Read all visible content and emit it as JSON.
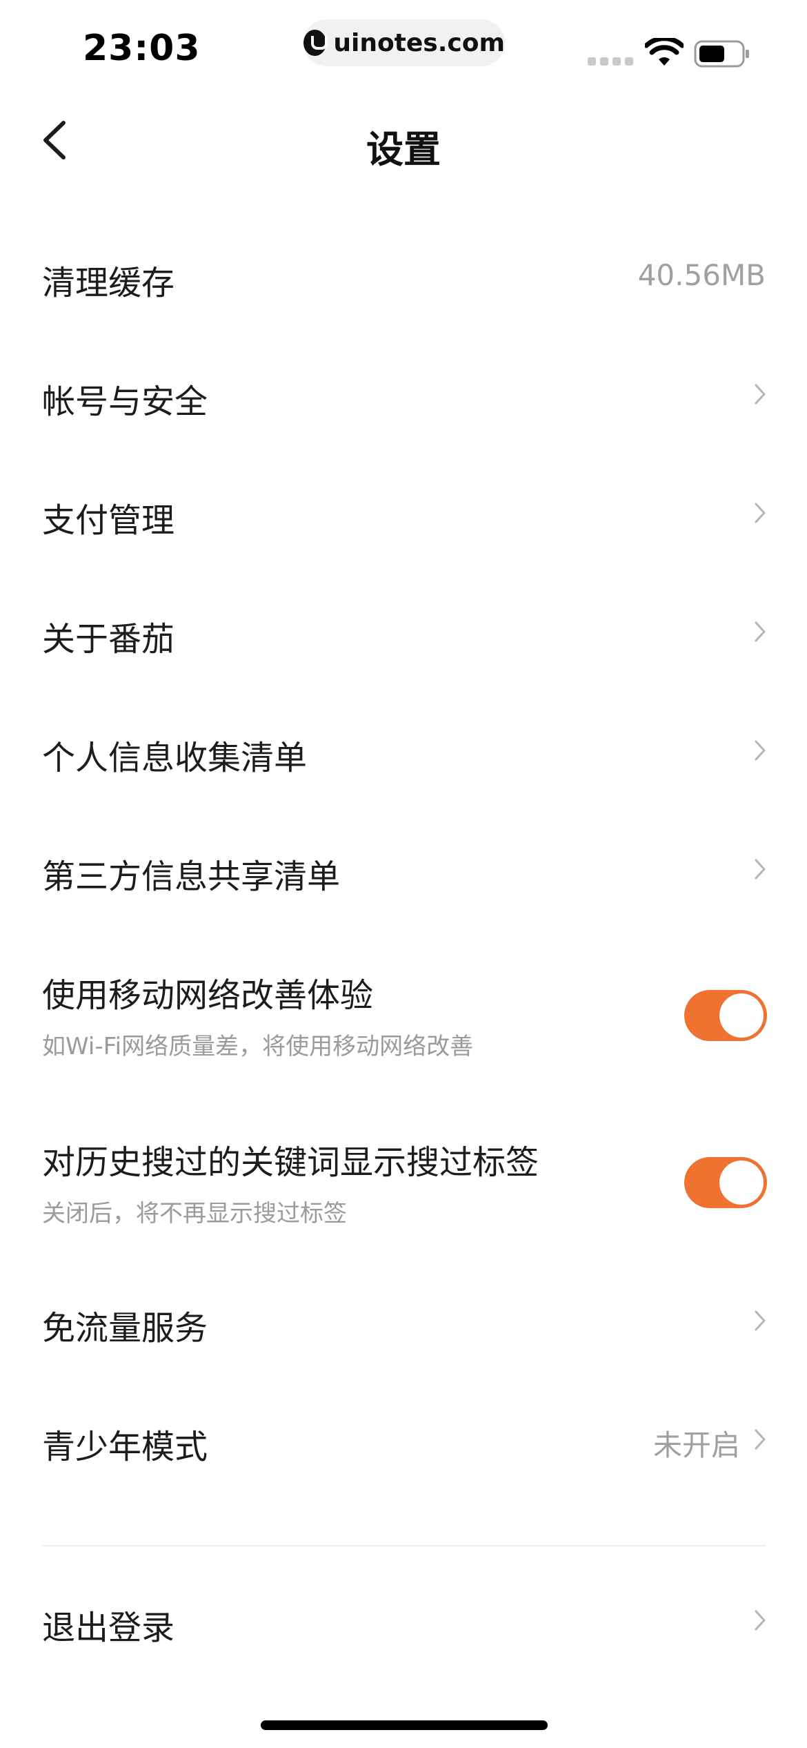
{
  "status_bar": {
    "time": "23:03",
    "watermark": "uinotes.com"
  },
  "nav": {
    "title": "设置"
  },
  "settings": {
    "clear_cache": {
      "label": "清理缓存",
      "value": "40.56MB"
    },
    "account_security": {
      "label": "帐号与安全"
    },
    "payment": {
      "label": "支付管理"
    },
    "about": {
      "label": "关于番茄"
    },
    "personal_info_list": {
      "label": "个人信息收集清单"
    },
    "third_party_list": {
      "label": "第三方信息共享清单"
    },
    "mobile_network": {
      "label": "使用移动网络改善体验",
      "subtitle": "如Wi-Fi网络质量差，将使用移动网络改善",
      "enabled": true
    },
    "search_tags": {
      "label": "对历史搜过的关键词显示搜过标签",
      "subtitle": "关闭后，将不再显示搜过标签",
      "enabled": true
    },
    "free_data": {
      "label": "免流量服务"
    },
    "teen_mode": {
      "label": "青少年模式",
      "value": "未开启"
    },
    "logout": {
      "label": "退出登录"
    }
  },
  "colors": {
    "accent": "#f07230",
    "secondary_text": "#9b9b9b"
  }
}
